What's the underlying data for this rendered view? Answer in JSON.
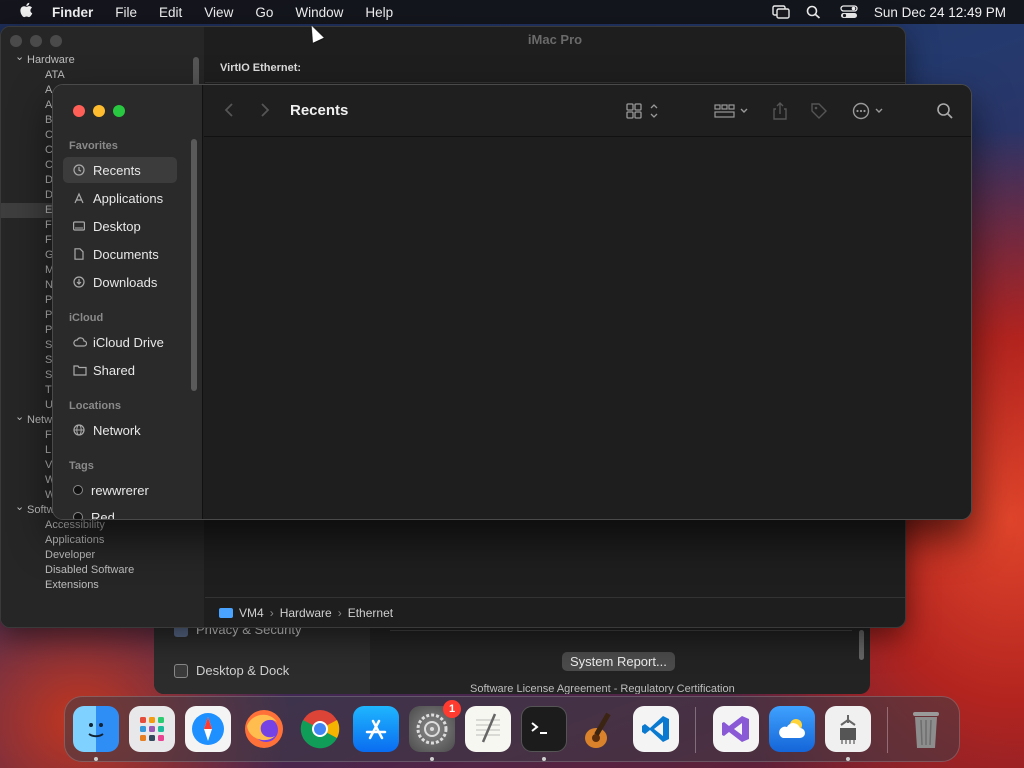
{
  "menubar": {
    "app": "Finder",
    "items": [
      "File",
      "Edit",
      "View",
      "Go",
      "Window",
      "Help"
    ],
    "clock": "Sun Dec 24  12:49 PM"
  },
  "sysinfo": {
    "title": "iMac Pro",
    "header": "VirtIO Ethernet:",
    "tree": [
      {
        "label": "Hardware",
        "type": "sec"
      },
      {
        "label": "ATA",
        "type": "leaf"
      },
      {
        "label": "A",
        "type": "leaf"
      },
      {
        "label": "A",
        "type": "leaf"
      },
      {
        "label": "B",
        "type": "leaf"
      },
      {
        "label": "C",
        "type": "leaf"
      },
      {
        "label": "C",
        "type": "leaf"
      },
      {
        "label": "C",
        "type": "leaf"
      },
      {
        "label": "D",
        "type": "leaf"
      },
      {
        "label": "D",
        "type": "leaf"
      },
      {
        "label": "E",
        "type": "leaf",
        "selected": true
      },
      {
        "label": "F",
        "type": "leaf"
      },
      {
        "label": "F",
        "type": "leaf"
      },
      {
        "label": "G",
        "type": "leaf"
      },
      {
        "label": "M",
        "type": "leaf"
      },
      {
        "label": "N",
        "type": "leaf"
      },
      {
        "label": "P",
        "type": "leaf"
      },
      {
        "label": "P",
        "type": "leaf"
      },
      {
        "label": "P",
        "type": "leaf"
      },
      {
        "label": "S",
        "type": "leaf"
      },
      {
        "label": "S",
        "type": "leaf"
      },
      {
        "label": "S",
        "type": "leaf"
      },
      {
        "label": "T",
        "type": "leaf"
      },
      {
        "label": "U",
        "type": "leaf"
      },
      {
        "label": "Netw",
        "type": "sec"
      },
      {
        "label": "F",
        "type": "leaf"
      },
      {
        "label": "L",
        "type": "leaf"
      },
      {
        "label": "V",
        "type": "leaf"
      },
      {
        "label": "W",
        "type": "leaf"
      },
      {
        "label": "Wi-Fi",
        "type": "leaf"
      },
      {
        "label": "Software",
        "type": "sec"
      },
      {
        "label": "Accessibility",
        "type": "leaf"
      },
      {
        "label": "Applications",
        "type": "leaf"
      },
      {
        "label": "Developer",
        "type": "leaf"
      },
      {
        "label": "Disabled Software",
        "type": "leaf"
      },
      {
        "label": "Extensions",
        "type": "leaf"
      }
    ],
    "path": [
      "VM4",
      "Hardware",
      "Ethernet"
    ],
    "path_sep": "›"
  },
  "settings": {
    "item1": "Privacy & Security",
    "item2": "Desktop & Dock",
    "system_report": "System Report...",
    "links": "Software License Agreement  -  Regulatory Certification"
  },
  "finder": {
    "title": "Recents",
    "favorites_header": "Favorites",
    "favorites": [
      "Recents",
      "Applications",
      "Desktop",
      "Documents",
      "Downloads"
    ],
    "icloud_header": "iCloud",
    "icloud": [
      "iCloud Drive",
      "Shared"
    ],
    "locations_header": "Locations",
    "locations": [
      "Network"
    ],
    "tags_header": "Tags",
    "tags": [
      "rewwrerer",
      "Red"
    ]
  },
  "dock": {
    "badge": "1",
    "apps": [
      "finder",
      "launchpad",
      "safari",
      "firefox",
      "chrome",
      "app-store",
      "system-settings",
      "textedit",
      "terminal",
      "garageband",
      "vscode",
      "visual-studio",
      "weather",
      "system-information",
      "trash"
    ]
  },
  "colors": {
    "close": "#ff5f57",
    "minimize": "#febc2e",
    "zoom": "#28c840",
    "selection": "#3c3c3c"
  }
}
